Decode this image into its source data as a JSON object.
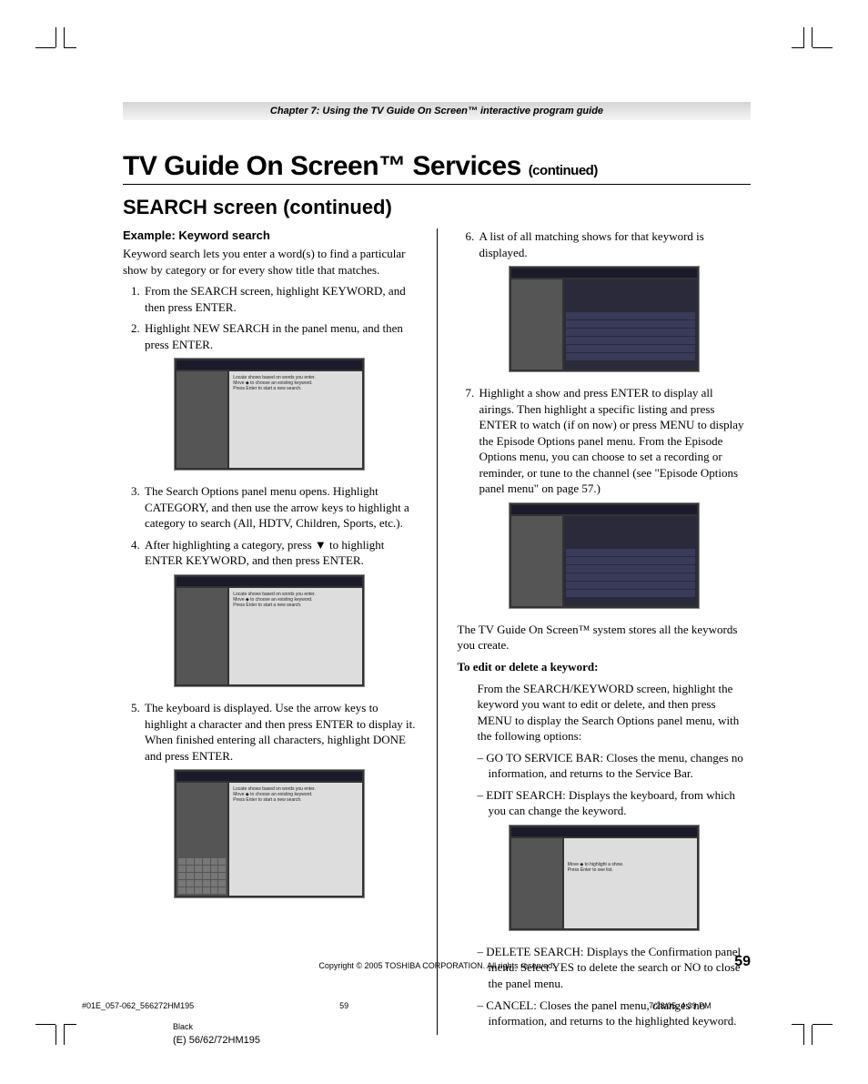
{
  "chapter_bar": "Chapter 7: Using the TV Guide On Screen™ interactive program guide",
  "h1_main": "TV Guide On Screen™ Services ",
  "h1_cont": "(continued)",
  "h2": "SEARCH screen (continued)",
  "h3": "Example: Keyword search",
  "intro": "Keyword search lets you enter a word(s) to find a particular show by category or for every show title that matches.",
  "left_steps": {
    "s1": "From the SEARCH screen, highlight KEYWORD, and then press ENTER.",
    "s2": "Highlight NEW SEARCH in the panel menu, and then press ENTER.",
    "s3": "The Search Options panel menu opens. Highlight CATEGORY, and then use the arrow keys to highlight a category to search (All, HDTV, Children, Sports, etc.).",
    "s4_a": "After highlighting a category, press ",
    "s4_tri": "▼",
    "s4_b": " to highlight ENTER KEYWORD, and then press ENTER.",
    "s5": "The keyboard is displayed. Use the arrow keys to highlight a character and then press ENTER to display it. When finished entering all characters, highlight DONE and press ENTER."
  },
  "right_steps": {
    "s6": "A list of all matching shows for that keyword is displayed.",
    "s7": "Highlight a show and press ENTER to display all airings. Then highlight a specific listing and press ENTER to watch (if on now) or press MENU to display the Episode Options panel menu. From the Episode Options menu, you can choose to set a recording or reminder, or tune to the channel (see \"Episode Options panel menu\" on page 57.)"
  },
  "post_steps": "The TV Guide On Screen™ system stores all the keywords you create.",
  "edit_heading": "To edit or delete a keyword:",
  "edit_intro": "From the SEARCH/KEYWORD screen, highlight the keyword you want to edit or delete, and then press MENU to display the Search Options panel menu, with the following options:",
  "dash": {
    "d1": "– GO TO SERVICE BAR: Closes the menu, changes no information, and returns to the Service Bar.",
    "d2": "– EDIT SEARCH: Displays the keyboard, from which you can change the keyword.",
    "d3": "– DELETE SEARCH: Displays the Confirmation panel menu. Select YES to delete the search or NO to close the panel menu.",
    "d4": "– CANCEL: Closes the panel menu, changes no information, and returns to the highlighted keyword."
  },
  "copyright": "Copyright © 2005 TOSHIBA CORPORATION. All rights reserved.",
  "pagenum": "59",
  "print": {
    "file": "#01E_057-062_566272HM195",
    "pg": "59",
    "dt": "7/28/05, 4:39 PM",
    "color": "Black",
    "model": "(E) 56/62/72HM195"
  }
}
